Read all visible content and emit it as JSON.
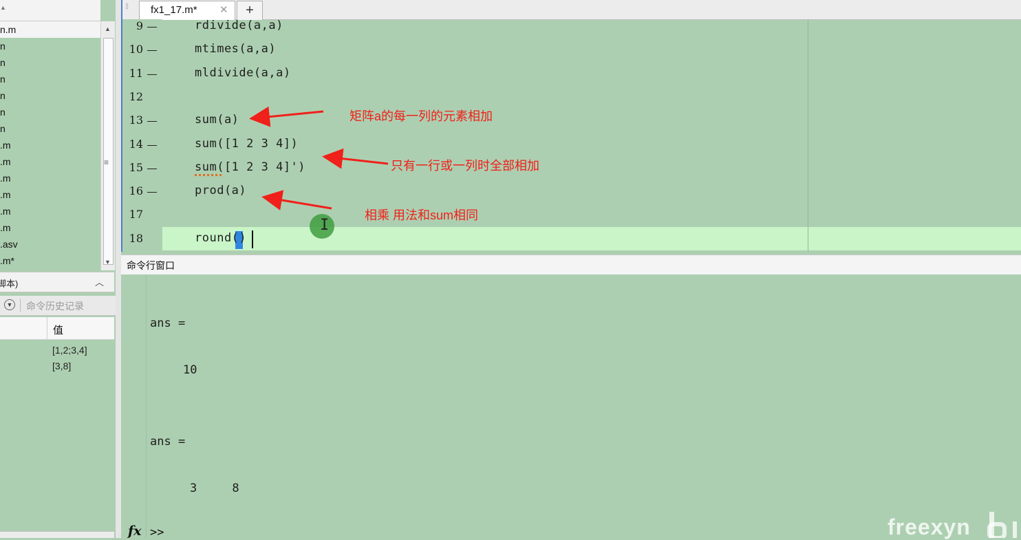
{
  "left_panel": {
    "files": [
      "n.m",
      "n",
      "n",
      "n",
      "n",
      "n",
      "n",
      ".m",
      ".m",
      ".m",
      ".m",
      ".m",
      ".m",
      ".asv",
      ".m*"
    ],
    "details_label": "脚本)",
    "history_label": "命令历史记录",
    "workspace": {
      "value_header": "值",
      "values": [
        "[1,2;3,4]",
        "[3,8]"
      ]
    }
  },
  "editor": {
    "tab_name": "fx1_17.m*",
    "tab_close": "✕",
    "tab_add": "+",
    "lines": [
      {
        "num": "9",
        "code": "rdivide(a,a)",
        "breakpoint_dash": true
      },
      {
        "num": "10",
        "code": "mtimes(a,a)",
        "breakpoint_dash": true
      },
      {
        "num": "11",
        "code": "mldivide(a,a)",
        "breakpoint_dash": true
      },
      {
        "num": "12",
        "code": "",
        "breakpoint_dash": false
      },
      {
        "num": "13",
        "code": "sum(a)",
        "breakpoint_dash": true
      },
      {
        "num": "14",
        "code": "sum([1 2 3 4])",
        "breakpoint_dash": true
      },
      {
        "num": "15",
        "code": "sum([1 2 3 4]')",
        "breakpoint_dash": true
      },
      {
        "num": "16",
        "code": "prod(a)",
        "breakpoint_dash": true
      },
      {
        "num": "17",
        "code": "",
        "breakpoint_dash": false
      },
      {
        "num": "18",
        "code": "round()",
        "breakpoint_dash": false
      }
    ],
    "annotations": [
      "矩阵a的每一列的元素相加",
      "只有一行或一列时全部相加",
      "相乘 用法和sum相同"
    ],
    "annotation_color": "#f0201a",
    "current_line_color": "#c9f5c9",
    "background_color": "#adcfb1"
  },
  "command_window": {
    "title": "命令行窗口",
    "output": [
      "ans =",
      "10",
      "ans =",
      "3     8"
    ],
    "fx_label": "fx",
    "prompt": ">>"
  },
  "watermark": "freexyn"
}
